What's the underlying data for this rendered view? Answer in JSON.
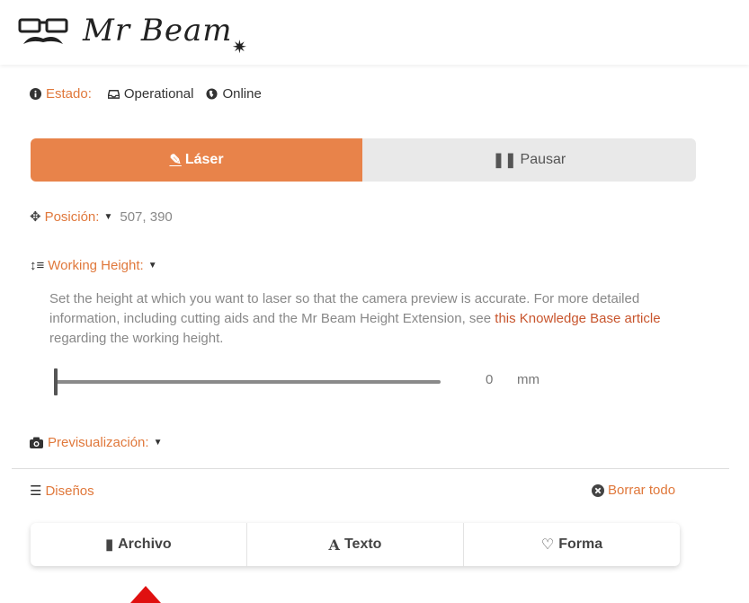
{
  "brand": {
    "name": "Mr Beam",
    "star": "✷"
  },
  "status": {
    "label": "Estado:",
    "state": "Operational",
    "connection": "Online"
  },
  "actions": {
    "laser_label": "Láser",
    "pause_label": "Pausar"
  },
  "position": {
    "label": "Posición:",
    "coords": "507, 390"
  },
  "working_height": {
    "label": "Working Height:",
    "desc_before": "Set the height at which you want to laser so that the camera preview is accurate. For more detailed information, including cutting aids and the Mr Beam Height Extension, see ",
    "link_text": "this Knowledge Base article",
    "desc_after": " regarding the working height.",
    "value": "0",
    "unit": "mm"
  },
  "preview": {
    "label": "Previsualización:"
  },
  "designs": {
    "label": "Diseños",
    "clear_all": "Borrar todo"
  },
  "tabs": [
    {
      "label": "Archivo",
      "icon": "file-icon",
      "glyph": "▮"
    },
    {
      "label": "Texto",
      "icon": "text-icon",
      "glyph": "A"
    },
    {
      "label": "Forma",
      "icon": "heart-icon",
      "glyph": "♡"
    }
  ],
  "colors": {
    "accent": "#e8834a",
    "link": "#c8552d",
    "marker": "#e01010"
  }
}
